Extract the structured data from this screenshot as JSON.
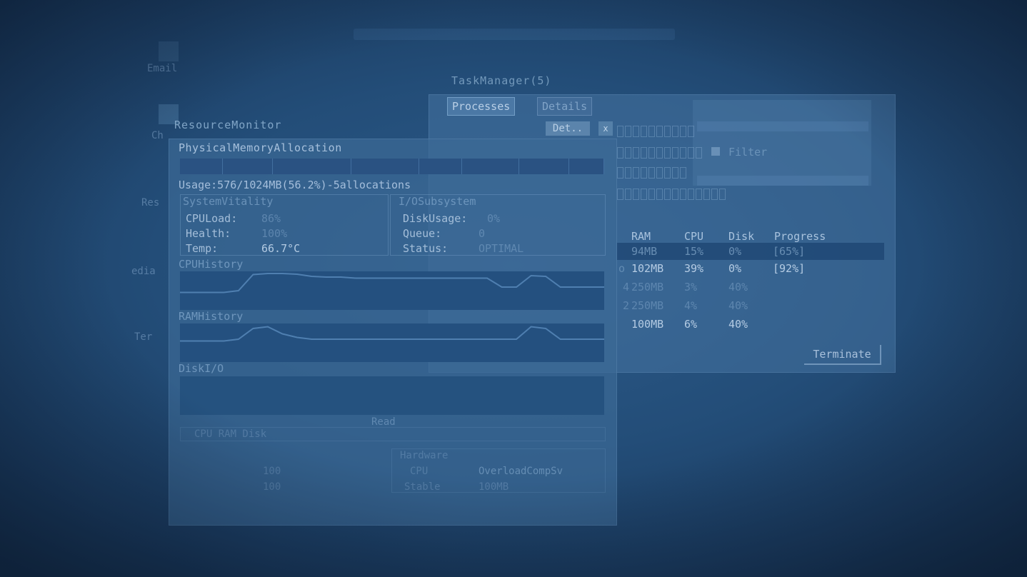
{
  "desktop": {
    "icons": [
      {
        "label": "Email"
      },
      {
        "label": "Ch"
      },
      {
        "label": "Res"
      },
      {
        "label": "edia"
      },
      {
        "label": "Ter"
      }
    ]
  },
  "task_manager": {
    "title": "TaskManager(5)",
    "tabs": [
      "Processes",
      "Details"
    ],
    "action_button": "Det..",
    "close_glyph": "x",
    "side_label": "Filter",
    "columns": [
      "RAM",
      "CPU",
      "Disk",
      "Progress"
    ],
    "rows": [
      {
        "prefix": "",
        "ram": "94MB",
        "cpu": "15%",
        "disk": "0%",
        "progress": "[65%]",
        "selected": true
      },
      {
        "prefix": "o",
        "ram": "102MB",
        "cpu": "39%",
        "disk": "0%",
        "progress": "[92%]",
        "selected": false
      },
      {
        "prefix": "4",
        "ram": "250MB",
        "cpu": "3%",
        "disk": "40%",
        "progress": "",
        "selected": false
      },
      {
        "prefix": "2",
        "ram": "250MB",
        "cpu": "4%",
        "disk": "40%",
        "progress": "",
        "selected": false
      },
      {
        "prefix": "",
        "ram": "100MB",
        "cpu": "6%",
        "disk": "40%",
        "progress": "",
        "selected": false
      }
    ],
    "terminate_label": "Terminate"
  },
  "resource_monitor": {
    "title": "ResourceMonitor",
    "memory": {
      "heading": "PhysicalMemoryAllocation",
      "usage": "Usage:576/1024MB(56.2%)-5allocations"
    },
    "system_vitality": {
      "title": "SystemVitality",
      "cpu_label": "CPULoad:",
      "cpu_value": "86%",
      "health_label": "Health:",
      "health_value": "100%",
      "temp_label": "Temp:",
      "temp_value": "66.7°C"
    },
    "io_subsystem": {
      "title": "I/OSubsystem",
      "disk_label": "DiskUsage:",
      "disk_value": "0%",
      "queue_label": "Queue:",
      "queue_value": "0",
      "status_label": "Status:",
      "status_value": "OPTIMAL"
    },
    "cpu_history": {
      "title": "CPUHistory",
      "levels": [
        0.45,
        0.45,
        0.45,
        0.45,
        0.5,
        0.95,
        0.98,
        0.98,
        0.96,
        0.9,
        0.88,
        0.88,
        0.85,
        0.85,
        0.85,
        0.85,
        0.85,
        0.85,
        0.85,
        0.85,
        0.85,
        0.85,
        0.6,
        0.6,
        0.92,
        0.9,
        0.6,
        0.6,
        0.6,
        0.6
      ]
    },
    "ram_history": {
      "title": "RAMHistory",
      "levels": [
        0.55,
        0.55,
        0.55,
        0.55,
        0.6,
        0.9,
        0.95,
        0.75,
        0.65,
        0.6,
        0.6,
        0.6,
        0.6,
        0.6,
        0.6,
        0.6,
        0.6,
        0.6,
        0.6,
        0.6,
        0.6,
        0.6,
        0.6,
        0.6,
        0.95,
        0.9,
        0.6,
        0.6,
        0.6,
        0.6
      ]
    },
    "disk_io": {
      "title": "DiskI/O",
      "caption": "Read"
    },
    "lower": {
      "legend": "CPU RAM Disk",
      "section2": "Hardware",
      "cpu_label": "CPU",
      "cpu_model": "OverloadCompSv",
      "r1": "100",
      "r2": "100",
      "r3": "Stable",
      "r4": "100MB"
    }
  }
}
